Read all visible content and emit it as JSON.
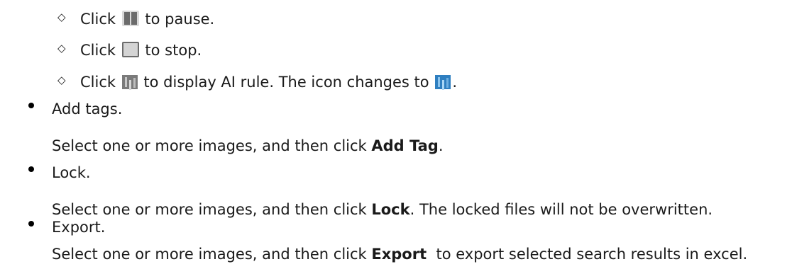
{
  "playback_items": [
    {
      "pre": "Click",
      "icon": "pause-icon",
      "post": "to pause."
    },
    {
      "pre": "Click",
      "icon": "stop-icon",
      "post": "to stop."
    },
    {
      "pre": "Click",
      "icon": "ai-rule-off-icon",
      "post": "to display AI rule. The icon changes to",
      "icon2": "ai-rule-on-icon",
      "end": "."
    }
  ],
  "bullets": [
    {
      "title": "Add tags.",
      "desc_pre": "Select one or more images, and then click ",
      "desc_bold": "Add Tag",
      "desc_post": "."
    },
    {
      "title": "Lock.",
      "desc_pre": "Select one or more images, and then click ",
      "desc_bold": "Lock",
      "desc_post": ". The locked files will not be overwritten."
    },
    {
      "title": "Export.",
      "desc_pre": "Select one or more images, and then click ",
      "desc_bold": "Export",
      "desc_post": "  to export selected search results in excel."
    }
  ],
  "symbols": {
    "diamond": "◇"
  }
}
